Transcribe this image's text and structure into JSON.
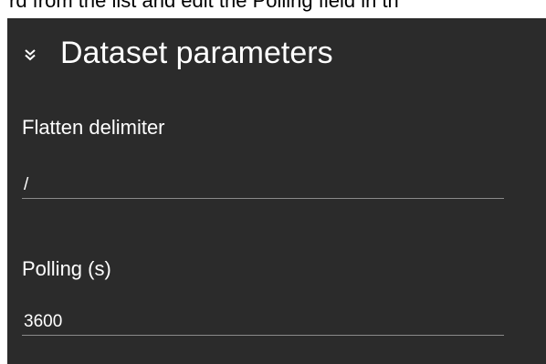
{
  "instruction_text": "rd from the list and edit the Polling field in th",
  "section": {
    "title": "Dataset parameters",
    "toggle_icon": "double-chevron-down-icon"
  },
  "fields": {
    "flatten_delimiter": {
      "label": "Flatten delimiter",
      "value": "/"
    },
    "polling": {
      "label": "Polling (s)",
      "value": "3600"
    }
  },
  "colors": {
    "panel_background": "#2b2b2b",
    "text": "#ffffff",
    "underline": "#8a8a8a"
  }
}
